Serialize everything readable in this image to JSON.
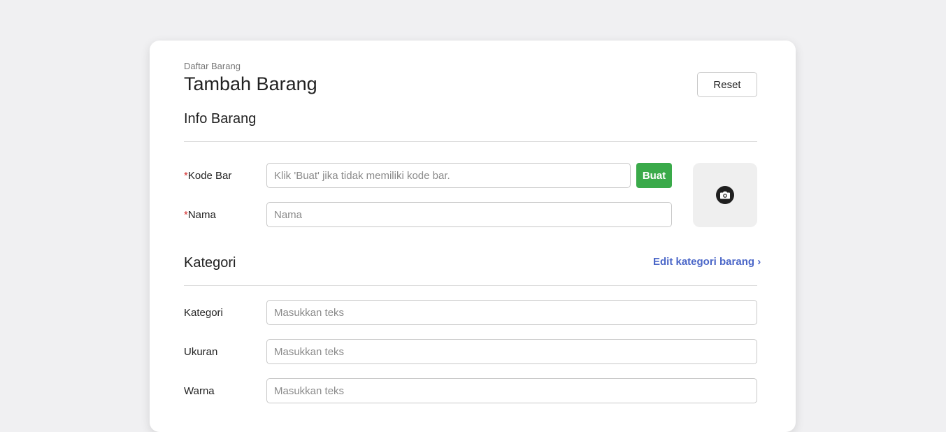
{
  "header": {
    "breadcrumb": "Daftar Barang",
    "title": "Tambah Barang",
    "reset_label": "Reset"
  },
  "info_section": {
    "title": "Info Barang",
    "kode_bar": {
      "required_mark": "*",
      "label": "Kode Bar",
      "placeholder": "Klik 'Buat' jika tidak memiliki kode bar.",
      "value": "",
      "generate_label": "Buat"
    },
    "nama": {
      "required_mark": "*",
      "label": "Nama",
      "placeholder": "Nama",
      "value": ""
    },
    "photo_icon": "camera-icon"
  },
  "kategori_section": {
    "title": "Kategori",
    "edit_link": "Edit kategori barang",
    "chevron": "›",
    "fields": [
      {
        "label": "Kategori",
        "placeholder": "Masukkan teks",
        "value": ""
      },
      {
        "label": "Ukuran",
        "placeholder": "Masukkan teks",
        "value": ""
      },
      {
        "label": "Warna",
        "placeholder": "Masukkan teks",
        "value": ""
      }
    ]
  },
  "colors": {
    "page_bg": "#f0f0f2",
    "card_bg": "#ffffff",
    "required": "#d32f2f",
    "primary_green": "#3aaa4a",
    "link_blue": "#4a66c8"
  }
}
